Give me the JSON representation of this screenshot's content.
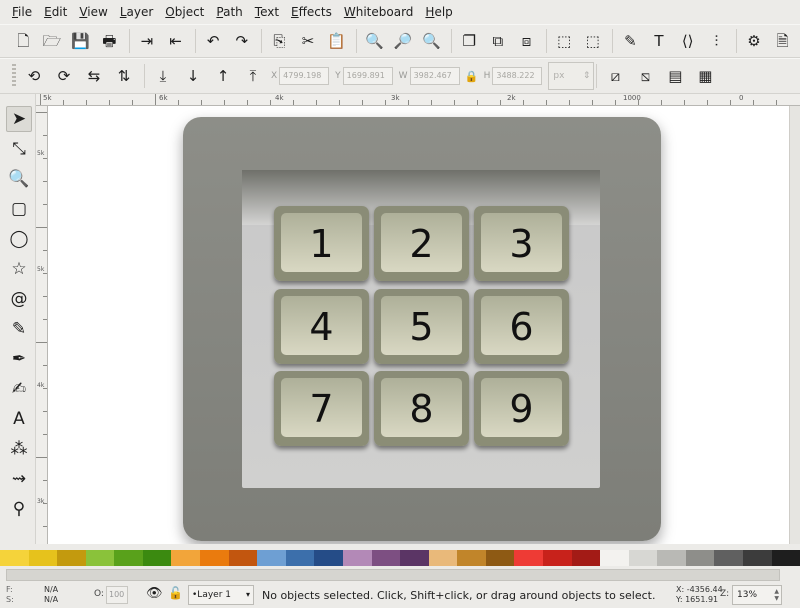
{
  "menu": [
    "File",
    "Edit",
    "View",
    "Layer",
    "Object",
    "Path",
    "Text",
    "Effects",
    "Whiteboard",
    "Help"
  ],
  "command_bar": {
    "groups": [
      [
        "new-document-icon",
        "open-document-icon",
        "save-icon",
        "print-icon"
      ],
      [
        "import-icon",
        "export-icon"
      ],
      [
        "undo-icon",
        "redo-icon"
      ],
      [
        "copy-icon",
        "cut-icon",
        "paste-icon"
      ],
      [
        "zoom-selection-icon",
        "zoom-drawing-icon",
        "zoom-page-icon"
      ],
      [
        "duplicate-icon",
        "clone-icon",
        "unlink-clone-icon"
      ],
      [
        "group-icon",
        "ungroup-icon"
      ],
      [
        "fill-stroke-icon",
        "text-font-icon",
        "xml-editor-icon",
        "align-icon"
      ],
      [
        "preferences-icon",
        "document-properties-icon"
      ]
    ],
    "glyphs": {
      "new-document-icon": "🗋",
      "open-document-icon": "🗁",
      "save-icon": "💾",
      "print-icon": "🖶",
      "import-icon": "⇥",
      "export-icon": "⇤",
      "undo-icon": "↶",
      "redo-icon": "↷",
      "copy-icon": "⎘",
      "cut-icon": "✂",
      "paste-icon": "📋",
      "zoom-selection-icon": "🔍",
      "zoom-drawing-icon": "🔎",
      "zoom-page-icon": "🔍",
      "duplicate-icon": "❐",
      "clone-icon": "⧉",
      "unlink-clone-icon": "⧈",
      "group-icon": "⬚",
      "ungroup-icon": "⬚",
      "fill-stroke-icon": "✎",
      "text-font-icon": "T",
      "xml-editor-icon": "⟨⟩",
      "align-icon": "⫶",
      "preferences-icon": "⚙",
      "document-properties-icon": "🗎"
    }
  },
  "controls_bar": {
    "x_label": "X",
    "x_value": "4799.198",
    "y_label": "Y",
    "y_value": "1699.891",
    "w_label": "W",
    "w_value": "3982.467",
    "h_label": "H",
    "h_value": "3488.222",
    "unit": "px"
  },
  "ruler_labels": [
    "5k",
    "6k",
    "4k",
    "3k",
    "2k",
    "1000",
    "0"
  ],
  "ruler_v_labels": [
    "5k",
    "5k",
    "4k",
    "3k"
  ],
  "tools": [
    "selector-tool-icon",
    "node-tool-icon",
    "zoom-tool-icon",
    "rectangle-tool-icon",
    "ellipse-tool-icon",
    "star-tool-icon",
    "spiral-tool-icon",
    "pencil-tool-icon",
    "pen-tool-icon",
    "calligraphy-tool-icon",
    "text-tool-icon",
    "spray-tool-icon",
    "connector-tool-icon",
    "dropper-tool-icon"
  ],
  "tool_glyphs": [
    "➤",
    "⤡",
    "🔍",
    "▢",
    "◯",
    "☆",
    "@",
    "✎",
    "✒",
    "✍",
    "A",
    "⁂",
    "⇝",
    "⚲"
  ],
  "keypad": {
    "keys": [
      "1",
      "2",
      "3",
      "4",
      "5",
      "6",
      "7",
      "8",
      "9"
    ]
  },
  "palette": [
    "#f5d33a",
    "#e6c21c",
    "#c39a0e",
    "#8ac23a",
    "#59a11b",
    "#3b8a10",
    "#f2a53a",
    "#ea7b0e",
    "#c2560f",
    "#6e9fd3",
    "#3c6fab",
    "#254c87",
    "#b389b7",
    "#7d4f82",
    "#5b3565",
    "#e9b97a",
    "#c1852a",
    "#8e5a14",
    "#ee3b35",
    "#c8221b",
    "#a31b16",
    "#f3f2ef",
    "#d7d7d3",
    "#b9b9b5",
    "#8e8e8a",
    "#606060",
    "#3c3c3c",
    "#1e1e1e"
  ],
  "status": {
    "fill_label": "F:",
    "stroke_label": "S:",
    "fill_value": "N/A",
    "stroke_value": "N/A",
    "opacity_label": "O:",
    "opacity_value": "100",
    "layer": "•Layer 1",
    "message": "No objects selected. Click, Shift+click, or drag around objects to select.",
    "x_coord": "X: -4356.44",
    "y_coord": "Y: 1651.91",
    "zoom_label": "Z:",
    "zoom": "13%"
  }
}
